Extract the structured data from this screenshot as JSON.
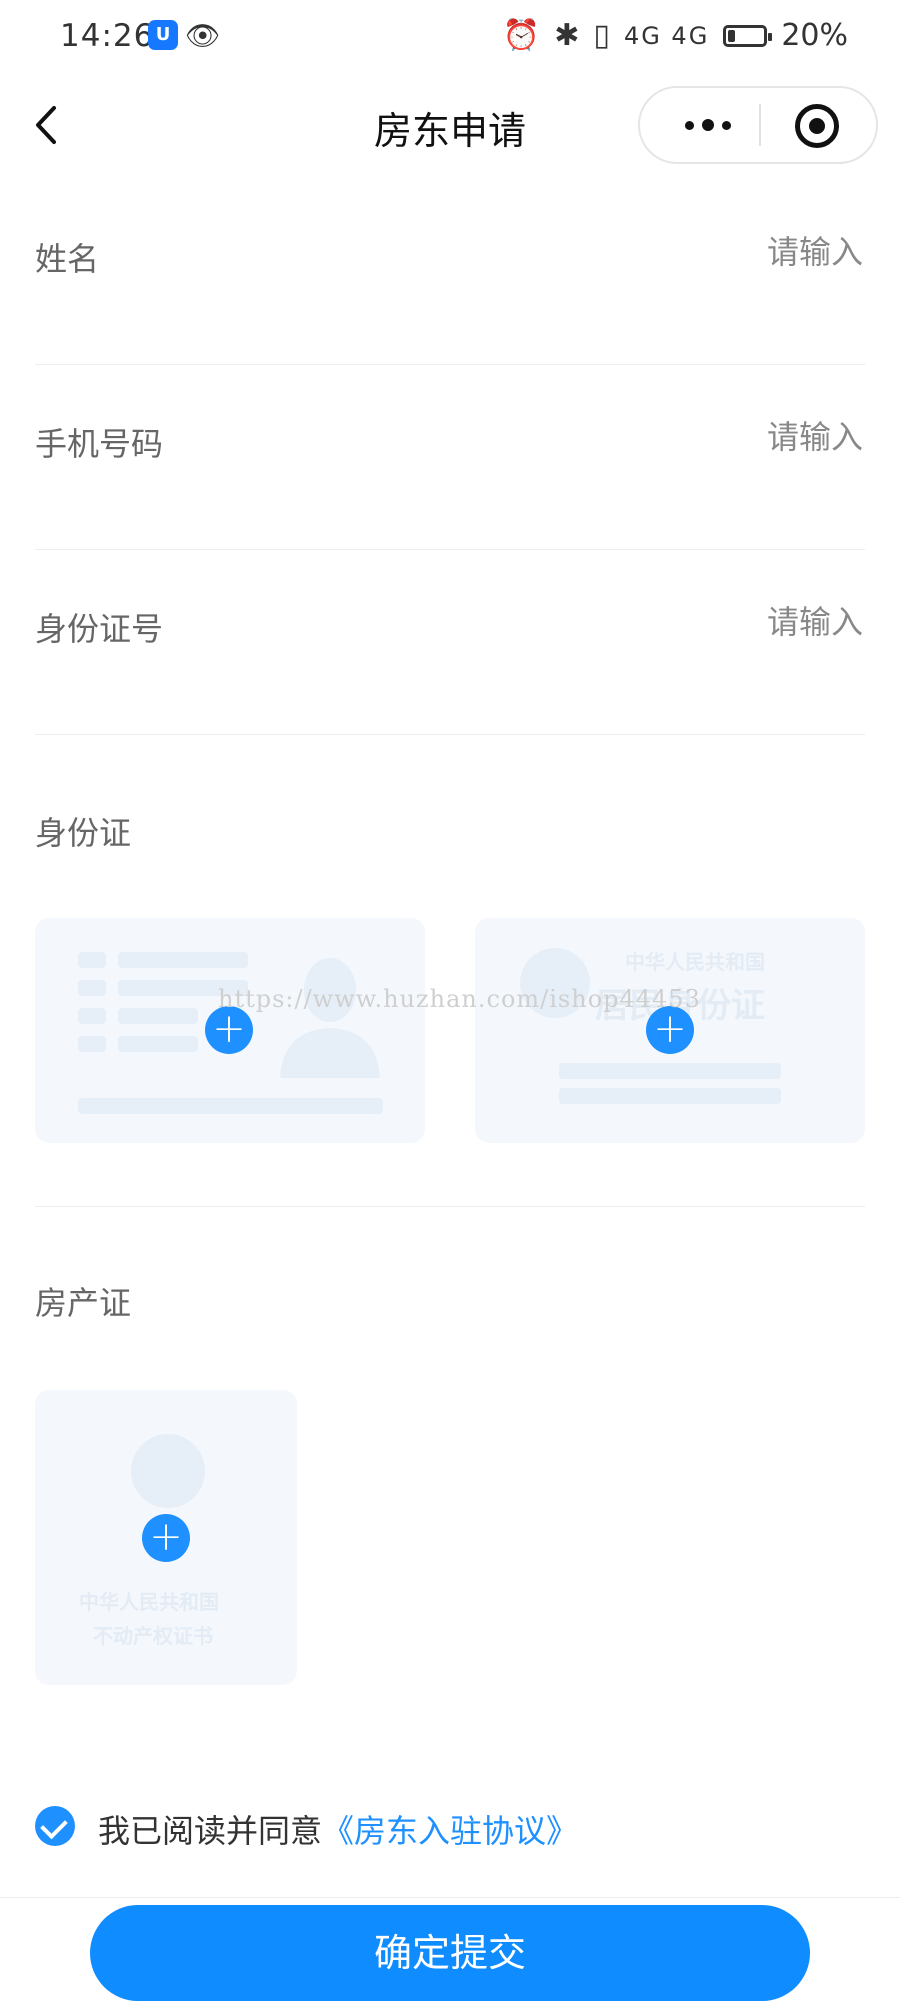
{
  "status_bar": {
    "time": "14:26",
    "signal_labels": "4G 4G",
    "battery": "20%",
    "battery_level": 0.2
  },
  "nav": {
    "title": "房东申请"
  },
  "form": {
    "fields": [
      {
        "label": "姓名",
        "placeholder": "请输入"
      },
      {
        "label": "手机号码",
        "placeholder": "请输入"
      },
      {
        "label": "身份证号",
        "placeholder": "请输入"
      }
    ],
    "id_card_label": "身份证",
    "id_card_back_text": {
      "line1": "中华人民共和国",
      "line2": "居民身份证"
    },
    "property_label": "房产证",
    "property_text": {
      "line1": "中华人民共和国",
      "line2": "不动产权证书"
    }
  },
  "watermark": "https://www.huzhan.com/ishop44453",
  "agreement": {
    "prefix": "我已阅读并同意",
    "link": "《房东入驻协议》",
    "checked": true
  },
  "submit": {
    "label": "确定提交"
  },
  "colors": {
    "accent": "#1e90ff",
    "placeholder_bg": "#f4f8fd"
  }
}
